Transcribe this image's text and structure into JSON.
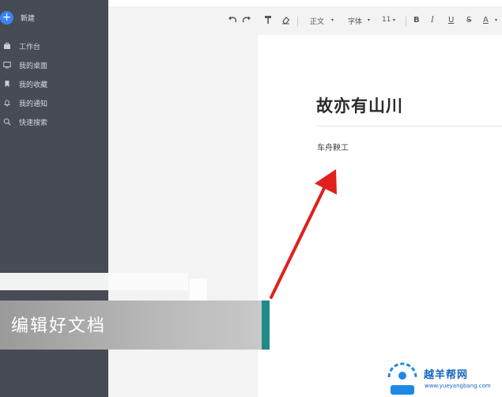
{
  "sidebar": {
    "new_label": "新建",
    "items": [
      {
        "label": "工作台",
        "icon": "briefcase-icon"
      },
      {
        "label": "我的桌面",
        "icon": "monitor-icon"
      },
      {
        "label": "我的收藏",
        "icon": "bookmark-icon"
      },
      {
        "label": "我的通知",
        "icon": "bell-icon"
      },
      {
        "label": "快速搜索",
        "icon": "search-icon"
      }
    ]
  },
  "toolbar": {
    "style_label": "正文",
    "font_label": "字体",
    "size_label": "11",
    "bold": "B",
    "italic": "I",
    "underline": "U",
    "strike": "S",
    "font_color": "A"
  },
  "document": {
    "title": "故亦有山川",
    "body": "车舟鞅工"
  },
  "caption": {
    "text": "编辑好文档"
  },
  "watermark": {
    "name": "越羊帮网",
    "url": "www.yueyangbang.com"
  },
  "colors": {
    "sidebar": "#474b54",
    "accent_blue": "#3b82f6",
    "arrow_red": "#e0201c",
    "caption_accent": "#1f8a86"
  }
}
